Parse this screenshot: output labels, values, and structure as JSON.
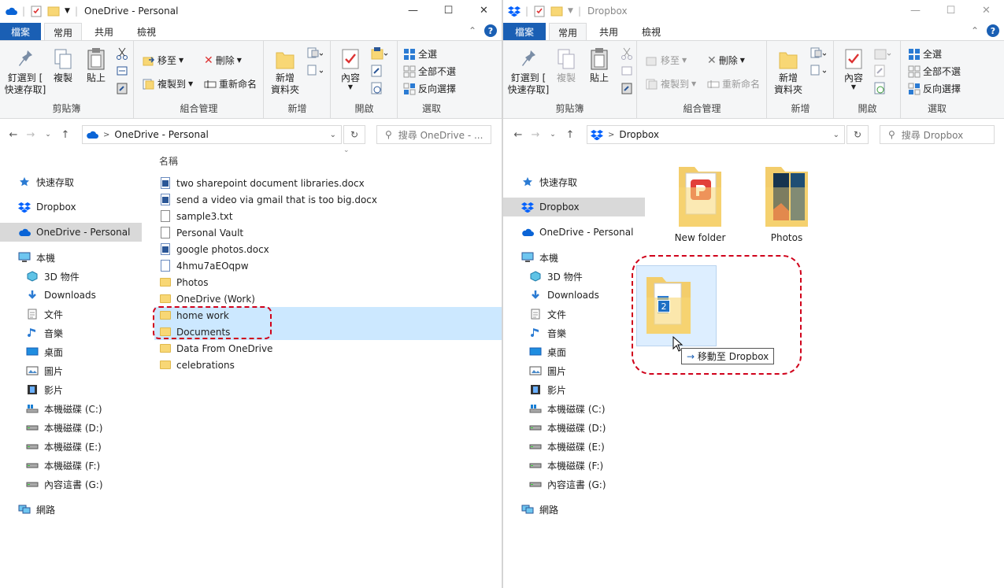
{
  "left": {
    "title": "OneDrive - Personal",
    "tabs": {
      "file": "檔案",
      "home": "常用",
      "share": "共用",
      "view": "檢視"
    },
    "ribbon": {
      "pin": "釘選到 [\n快速存取]",
      "copy": "複製",
      "paste": "貼上",
      "clipboard": "剪貼簿",
      "move_to": "移至",
      "delete": "刪除",
      "copy_to": "複製到",
      "rename": "重新命名",
      "organize": "組合管理",
      "new_folder": "新增\n資料夾",
      "new": "新增",
      "properties": "內容",
      "open": "開啟",
      "select_all": "全選",
      "select_none": "全部不選",
      "invert": "反向選擇",
      "select": "選取"
    },
    "address": {
      "path": "OneDrive - Personal",
      "search": "搜尋 OneDrive - ..."
    },
    "nav": [
      {
        "label": "快速存取",
        "icon": "star-icon"
      },
      {
        "label": "Dropbox",
        "icon": "dropbox-icon"
      },
      {
        "label": "OneDrive - Personal",
        "icon": "cloud-icon",
        "selected": true
      },
      {
        "label": "本機",
        "icon": "computer-icon"
      },
      {
        "label": "3D 物件",
        "icon": "cube-icon"
      },
      {
        "label": "Downloads",
        "icon": "download-icon"
      },
      {
        "label": "文件",
        "icon": "document-icon"
      },
      {
        "label": "音樂",
        "icon": "music-icon"
      },
      {
        "label": "桌面",
        "icon": "desktop-icon"
      },
      {
        "label": "圖片",
        "icon": "picture-icon"
      },
      {
        "label": "影片",
        "icon": "video-icon"
      },
      {
        "label": "本機磁碟 (C:)",
        "icon": "windows-drive-icon"
      },
      {
        "label": "本機磁碟 (D:)",
        "icon": "drive-icon"
      },
      {
        "label": "本機磁碟 (E:)",
        "icon": "drive-icon"
      },
      {
        "label": "本機磁碟 (F:)",
        "icon": "drive-icon"
      },
      {
        "label": "內容這書 (G:)",
        "icon": "drive-icon"
      },
      {
        "label": "網路",
        "icon": "network-icon"
      }
    ],
    "column_header": "名稱",
    "files": [
      {
        "name": "two sharepoint document libraries.docx",
        "type": "docx"
      },
      {
        "name": "send a video via gmail that is too big.docx",
        "type": "docx"
      },
      {
        "name": "sample3.txt",
        "type": "txt"
      },
      {
        "name": "Personal Vault",
        "type": "vault"
      },
      {
        "name": "google photos.docx",
        "type": "docx"
      },
      {
        "name": "4hmu7aEOqpw",
        "type": "file"
      },
      {
        "name": "Photos",
        "type": "folder"
      },
      {
        "name": "OneDrive (Work)",
        "type": "folder"
      },
      {
        "name": "home work",
        "type": "folder",
        "selected": true
      },
      {
        "name": "Documents",
        "type": "folder",
        "selected": true
      },
      {
        "name": "Data From OneDrive",
        "type": "folder"
      },
      {
        "name": "celebrations",
        "type": "folder"
      }
    ]
  },
  "right": {
    "title": "Dropbox",
    "address": {
      "path": "Dropbox",
      "search": "搜尋 Dropbox"
    },
    "nav_selected": "Dropbox",
    "tiles": [
      {
        "name": "New folder"
      },
      {
        "name": "Photos"
      }
    ],
    "drag": {
      "count": "2",
      "tooltip": "移動至 Dropbox"
    }
  },
  "colors": {
    "accent": "#1a5fb4",
    "selection": "#cce8ff",
    "highlight": "#d0021b",
    "folder": "#f8d775"
  }
}
